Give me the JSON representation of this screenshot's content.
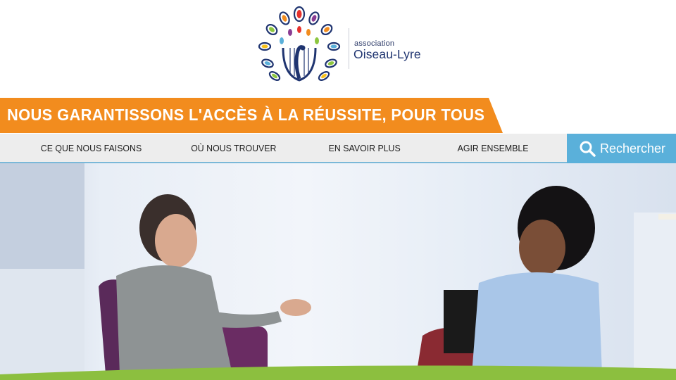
{
  "logo": {
    "small_text": "association",
    "name": "Oiseau-Lyre",
    "mark_icon": "peacock-lyre-logo"
  },
  "banner": {
    "tagline": "NOUS GARANTISSONS L'ACCÈS À LA RÉUSSITE, POUR TOUS",
    "color": "#f28c1e"
  },
  "nav": {
    "items": [
      {
        "label": "CE QUE NOUS FAISONS"
      },
      {
        "label": "OÙ NOUS TROUVER"
      },
      {
        "label": "EN SAVOIR PLUS"
      },
      {
        "label": "AGIR ENSEMBLE"
      }
    ],
    "search_label": "Rechercher",
    "search_icon": "search-icon",
    "accent": "#5ab0da"
  },
  "hero": {
    "image": "photo-two-women-conversation"
  }
}
